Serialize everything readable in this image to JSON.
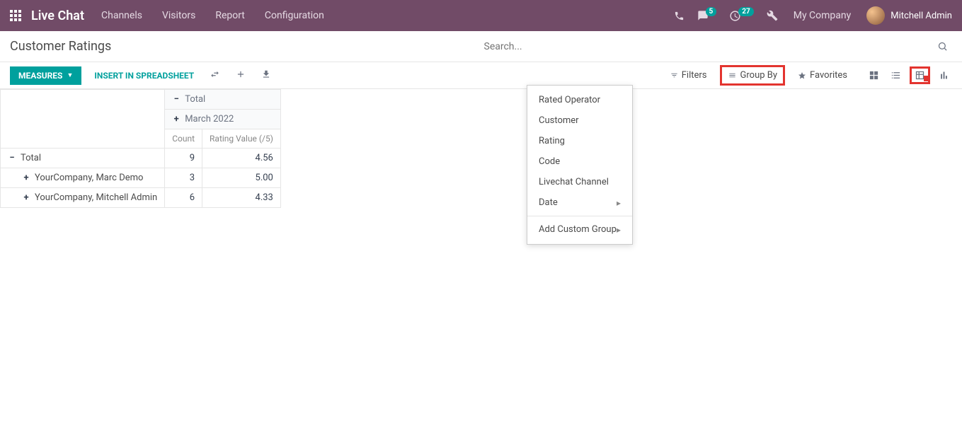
{
  "topbar": {
    "brand": "Live Chat",
    "nav": [
      "Channels",
      "Visitors",
      "Report",
      "Configuration"
    ],
    "msg_badge": "5",
    "activity_badge": "27",
    "company": "My Company",
    "user": "Mitchell Admin"
  },
  "page_title": "Customer Ratings",
  "search_placeholder": "Search...",
  "controls": {
    "measures": "MEASURES",
    "insert": "INSERT IN SPREADSHEET",
    "filters": "Filters",
    "group_by": "Group By",
    "favorites": "Favorites"
  },
  "groupby_menu": {
    "items": [
      "Rated Operator",
      "Customer",
      "Rating",
      "Code",
      "Livechat Channel",
      "Date"
    ],
    "has_submenu": [
      false,
      false,
      false,
      false,
      false,
      true
    ],
    "add_custom": "Add Custom Group"
  },
  "pivot": {
    "col_total": "Total",
    "col_period": "March 2022",
    "measures": [
      "Count",
      "Rating Value (/5)"
    ],
    "rows": [
      {
        "label": "Total",
        "indent": 0,
        "expanded": true,
        "count": "9",
        "rating": "4.56"
      },
      {
        "label": "YourCompany, Marc Demo",
        "indent": 1,
        "expanded": false,
        "count": "3",
        "rating": "5.00"
      },
      {
        "label": "YourCompany, Mitchell Admin",
        "indent": 1,
        "expanded": false,
        "count": "6",
        "rating": "4.33"
      }
    ]
  }
}
